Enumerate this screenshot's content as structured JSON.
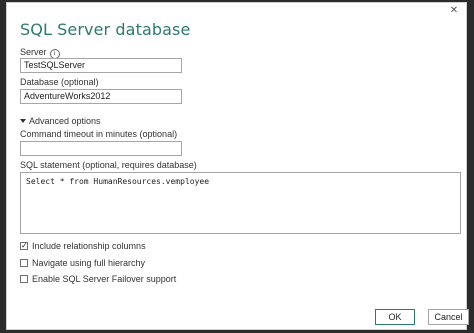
{
  "dialog": {
    "title": "SQL Server database",
    "close_glyph": "✕"
  },
  "server": {
    "label": "Server",
    "info_glyph": "i",
    "value": "TestSQLServer"
  },
  "database": {
    "label": "Database (optional)",
    "value": "AdventureWorks2012"
  },
  "advanced": {
    "toggle_label": "Advanced options",
    "timeout_label": "Command timeout in minutes (optional)",
    "timeout_value": "",
    "sql_label": "SQL statement (optional, requires database)",
    "sql_value": "Select * from HumanResources.vemployee",
    "options": [
      {
        "label": "Include relationship columns",
        "checked": true
      },
      {
        "label": "Navigate using full hierarchy",
        "checked": false
      },
      {
        "label": "Enable SQL Server Failover support",
        "checked": false
      }
    ]
  },
  "buttons": {
    "ok": "OK",
    "cancel": "Cancel"
  },
  "colors": {
    "accent": "#2b7a6e",
    "border": "#a6a6a6"
  }
}
